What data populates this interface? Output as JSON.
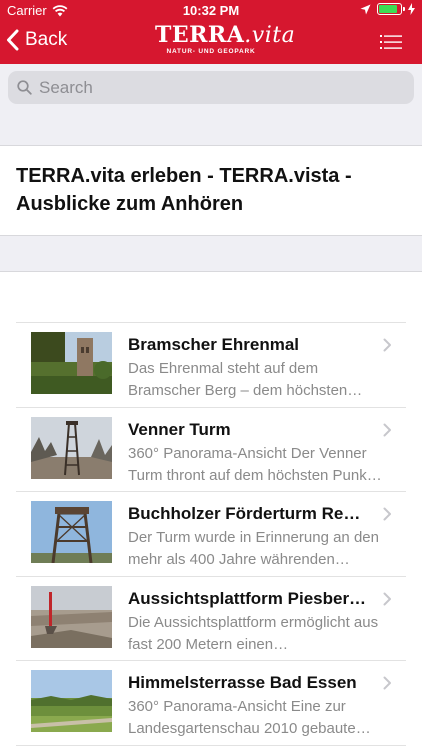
{
  "status_bar": {
    "carrier": "Carrier",
    "time": "10:32 PM"
  },
  "nav": {
    "back_label": "Back",
    "logo_main_a": "TERRA",
    "logo_main_b": ".vita",
    "logo_sub": "NATUR- UND GEOPARK"
  },
  "search": {
    "placeholder": "Search"
  },
  "page_title": "TERRA.vita erleben - TERRA.vista - Ausblicke zum Anhören",
  "items": [
    {
      "title": "Bramscher Ehrenmal",
      "description": "Das Ehrenmal steht auf dem Bramscher Berg – dem höchsten…"
    },
    {
      "title": "Venner Turm",
      "description": "360° Panorama-Ansicht Der Venner Turm thront auf dem höchsten Punk…"
    },
    {
      "title": "Buchholzer Förderturm Re…",
      "description": "Der Turm wurde in Erinnerung an den mehr als 400 Jahre währenden…"
    },
    {
      "title": "Aussichtsplattform Piesber…",
      "description": "Die Aussichtsplattform ermöglicht aus fast 200 Metern einen…"
    },
    {
      "title": "Himmelsterrasse Bad Essen",
      "description": "360° Panorama-Ansicht Eine zur Landesgartenschau 2010 gebaute…"
    }
  ],
  "colors": {
    "brand_red": "#d6172f",
    "background_grey": "#efeff4"
  }
}
